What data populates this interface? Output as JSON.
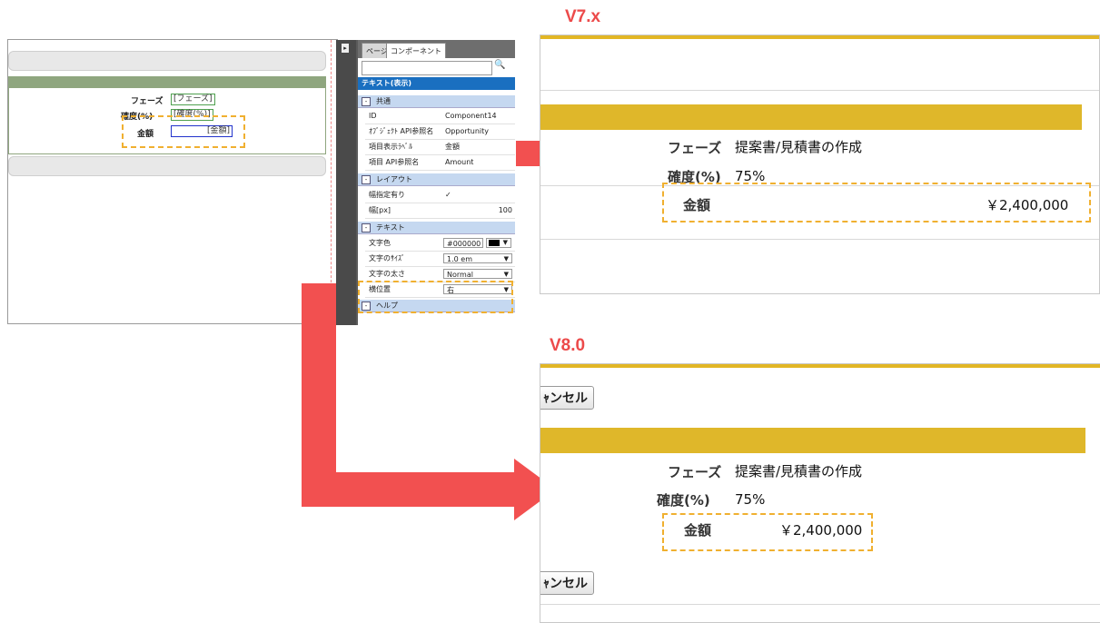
{
  "designer": {
    "fields": [
      {
        "label": "フェーズ",
        "value": "[フェーズ]"
      },
      {
        "label": "確度(%)",
        "value": "[確度(%)]"
      },
      {
        "label": "金額",
        "value": "[金額]"
      }
    ]
  },
  "panel": {
    "tabs": [
      "ページ",
      "コンポーネント"
    ],
    "search_placeholder": "",
    "title": "テキスト(表示)",
    "sections": {
      "common": "共通",
      "layout": "レイアウト",
      "text": "テキスト",
      "help": "ヘルプ"
    },
    "common_rows": [
      {
        "key": "ID",
        "value": "Component14"
      },
      {
        "key": "ｵﾌﾞｼﾞｪｸﾄ API参照名",
        "value": "Opportunity"
      },
      {
        "key": "項目表示ﾗﾍﾞﾙ",
        "value": "金額"
      },
      {
        "key": "項目 API参照名",
        "value": "Amount"
      }
    ],
    "layout_rows": [
      {
        "key": "幅指定有り",
        "value": "✓"
      },
      {
        "key": "幅[px]",
        "value": "100"
      }
    ],
    "text_rows": [
      {
        "key": "文字色",
        "value": "#000000"
      },
      {
        "key": "文字のｻｲｽﾞ",
        "value": "1.0 em"
      },
      {
        "key": "文字の太さ",
        "value": "Normal"
      },
      {
        "key": "横位置",
        "value": "右"
      }
    ]
  },
  "v7": {
    "version": "V7.x",
    "rows": [
      {
        "label": "フェーズ",
        "value": "提案書/見積書の作成"
      },
      {
        "label": "確度(%)",
        "value": "75%"
      },
      {
        "label": "金額",
        "value": "￥2,400,000"
      }
    ]
  },
  "v8": {
    "version": "V8.0",
    "cancel_label": "ｬンセル",
    "rows": [
      {
        "label": "フェーズ",
        "value": "提案書/見積書の作成"
      },
      {
        "label": "確度(%)",
        "value": "75%"
      },
      {
        "label": "金額",
        "value": "￥2,400,000"
      }
    ]
  },
  "colors": {
    "accent_red": "#f25050",
    "gold": "#dfb72a",
    "highlight_dash": "#f0b030",
    "panel_blue": "#1a6fc0"
  }
}
